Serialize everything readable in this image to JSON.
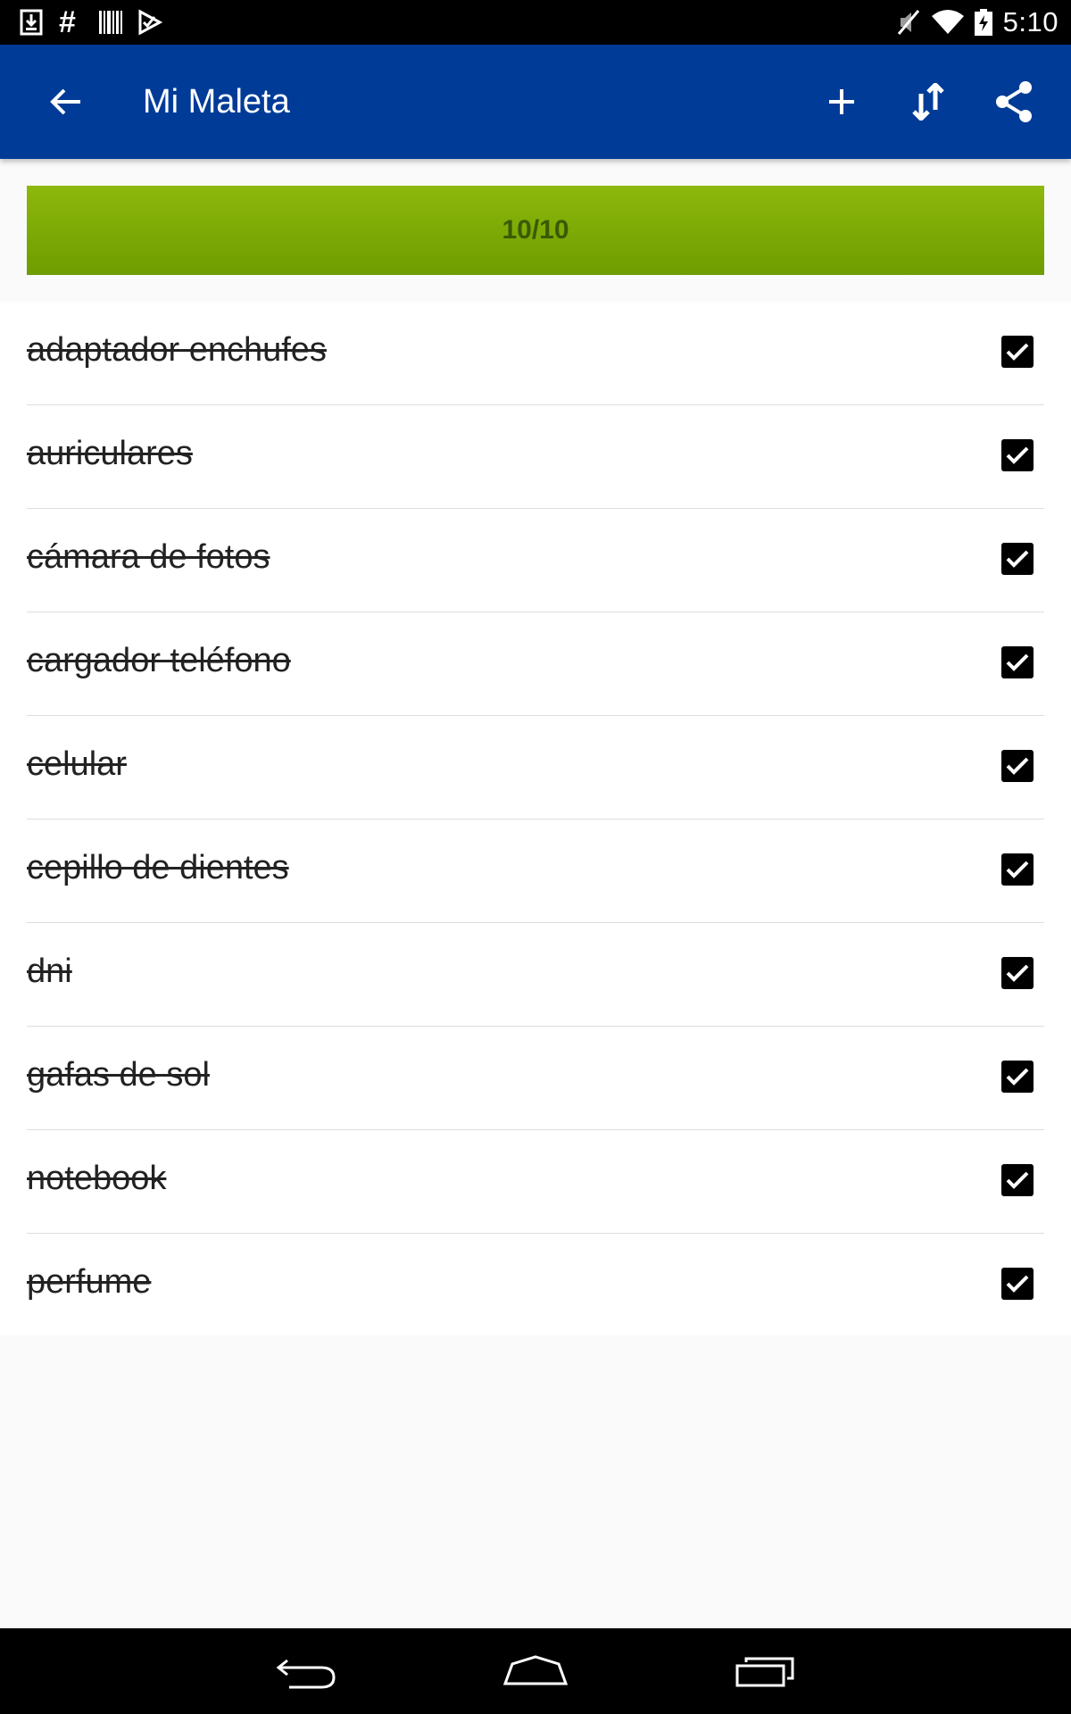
{
  "status_bar": {
    "time": "5:10",
    "left_icons": [
      "download-icon",
      "hash-icon",
      "barcode-icon",
      "task-icon"
    ],
    "right_icons": [
      "mute-icon",
      "wifi-icon",
      "battery-charging-icon"
    ]
  },
  "app_bar": {
    "title": "Mi Maleta",
    "actions": [
      "add-icon",
      "sort-icon",
      "share-icon"
    ],
    "color": "#003c97"
  },
  "progress": {
    "label": "10/10",
    "done": 10,
    "total": 10,
    "color": "#7fae06"
  },
  "items": [
    {
      "label": "adaptador enchufes",
      "checked": true
    },
    {
      "label": "auriculares",
      "checked": true
    },
    {
      "label": "cámara de fotos",
      "checked": true
    },
    {
      "label": "cargador teléfono",
      "checked": true
    },
    {
      "label": "celular",
      "checked": true
    },
    {
      "label": "cepillo de dientes",
      "checked": true
    },
    {
      "label": "dni",
      "checked": true
    },
    {
      "label": "gafas de sol",
      "checked": true
    },
    {
      "label": "notebook",
      "checked": true
    },
    {
      "label": "perfume",
      "checked": true
    }
  ],
  "nav_bar": {
    "buttons": [
      "back-icon",
      "home-icon",
      "recents-icon"
    ]
  }
}
